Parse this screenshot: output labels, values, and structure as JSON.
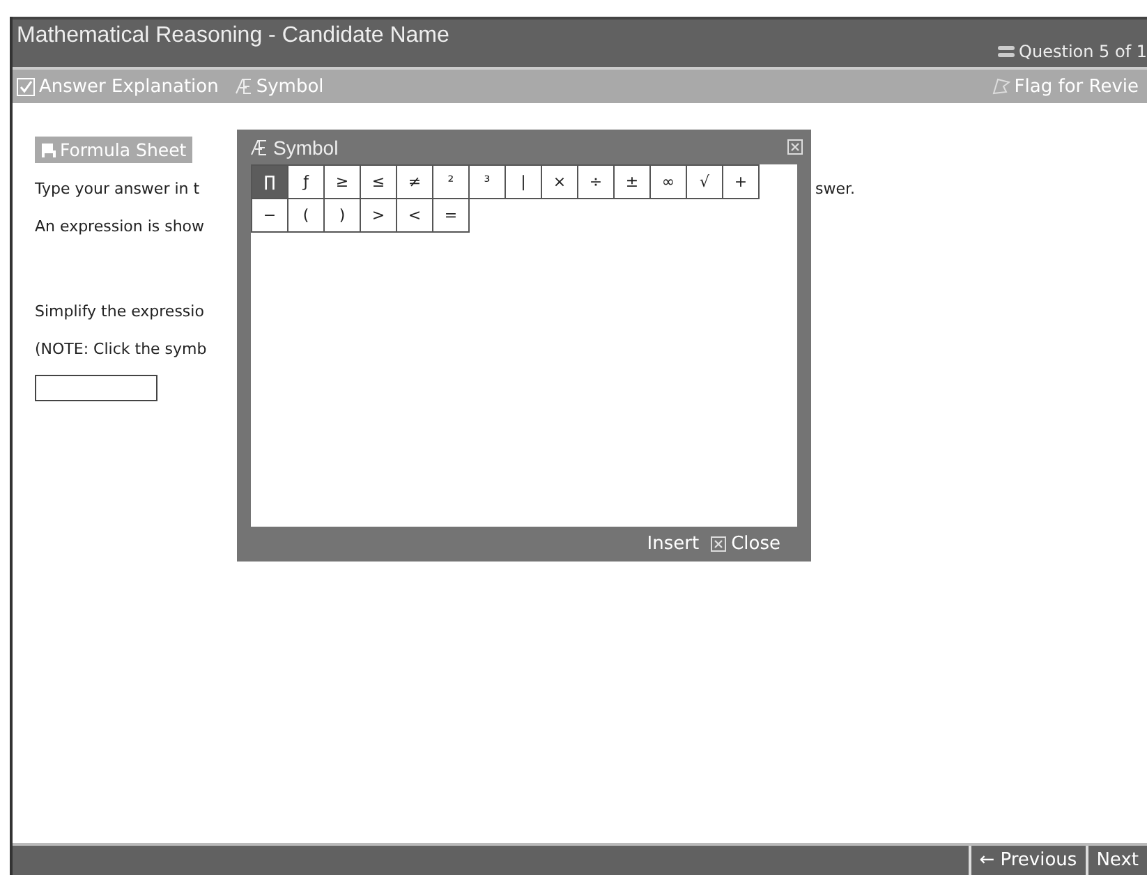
{
  "window": {
    "title": "Mathematical Reasoning - Candidate Name",
    "question_counter": "Question 5 of 1"
  },
  "toolbar": {
    "left": [
      {
        "label": "Answer Explanation",
        "kind": "check"
      },
      {
        "label": "Symbol",
        "kind": "symbol"
      }
    ],
    "flag": "Flag for Revie"
  },
  "content": {
    "formula_button": "Formula Sheet",
    "lines": [
      {
        "left": "Type your answer in t",
        "right": "swer."
      },
      {
        "left": "An expression is show"
      },
      {
        "left": "Simplify the expressio"
      },
      {
        "left": "(NOTE: Click the symb"
      }
    ]
  },
  "symbol_dialog": {
    "title": "Symbol",
    "symbols": [
      {
        "char": "∏",
        "selected": true
      },
      {
        "char": "ƒ",
        "selected": false
      },
      {
        "char": "≥",
        "selected": false
      },
      {
        "char": "≤",
        "selected": false
      },
      {
        "char": "≠",
        "selected": false
      },
      {
        "char": "²",
        "selected": false
      },
      {
        "char": "³",
        "selected": false
      },
      {
        "char": "|",
        "selected": false
      },
      {
        "char": "×",
        "selected": false
      },
      {
        "char": "÷",
        "selected": false
      },
      {
        "char": "±",
        "selected": false
      },
      {
        "char": "∞",
        "selected": false
      },
      {
        "char": "√",
        "selected": false
      },
      {
        "char": "+",
        "selected": false
      },
      {
        "char": "−",
        "selected": false
      },
      {
        "char": "(",
        "selected": false
      },
      {
        "char": ")",
        "selected": false
      },
      {
        "char": ">",
        "selected": false
      },
      {
        "char": "<",
        "selected": false
      },
      {
        "char": "=",
        "selected": false
      }
    ],
    "buttons": [
      "Insert",
      "Close"
    ]
  },
  "footer": {
    "buttons": [
      "← Previous",
      "Next"
    ]
  }
}
